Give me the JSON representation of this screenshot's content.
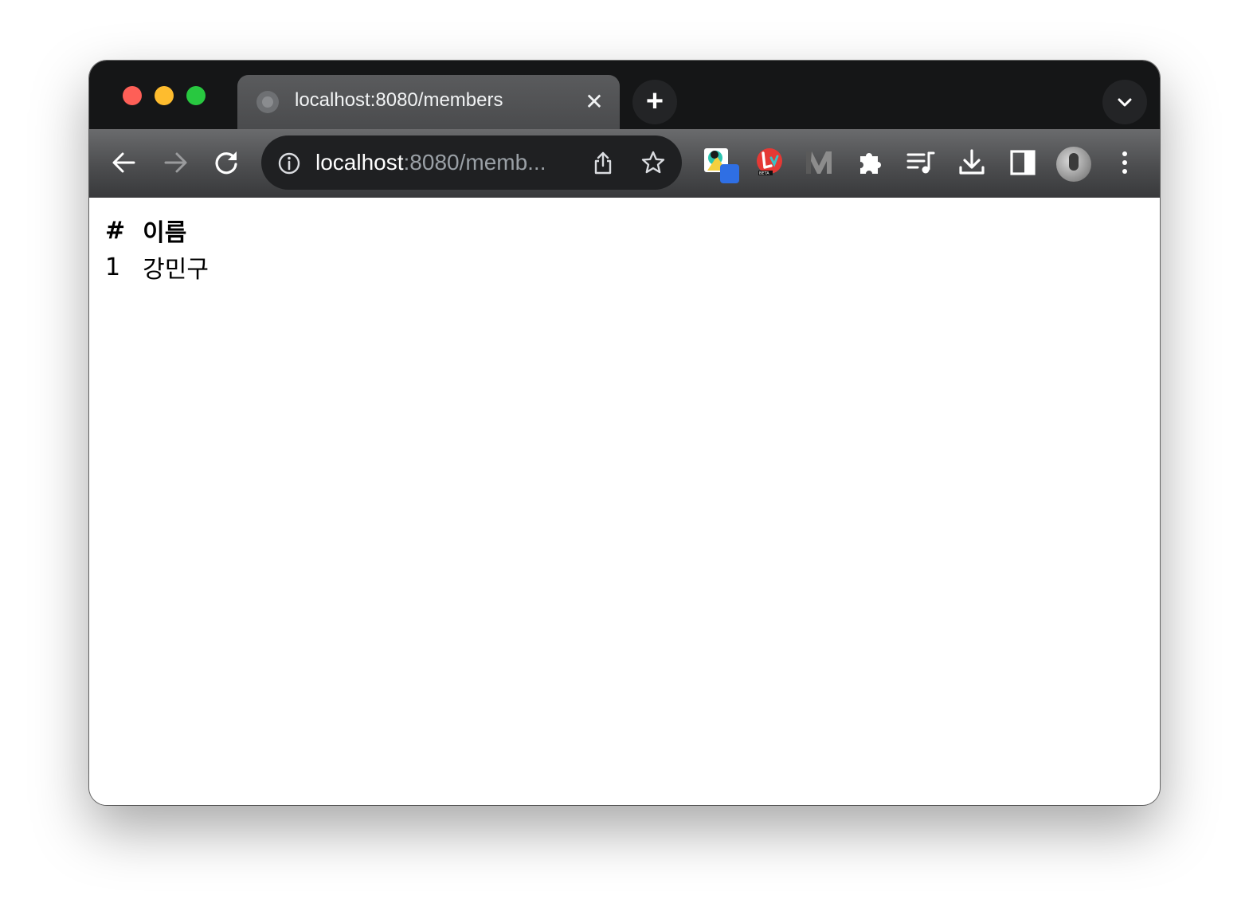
{
  "browser": {
    "tab": {
      "title": "localhost:8080/members",
      "close_glyph": "✕",
      "favicon": "globe-icon"
    },
    "new_tab_glyph": "+",
    "omnibox": {
      "url_host": "localhost",
      "url_rest": ":8080/memb..."
    },
    "extensions": [
      "extension-1",
      "extension-beta",
      "extension-m",
      "puzzle-icon",
      "media-icon",
      "download-icon",
      "sidepanel-icon",
      "profile-avatar",
      "menu-icon"
    ]
  },
  "page": {
    "table": {
      "headers": [
        "#",
        "이름"
      ],
      "rows": [
        [
          "1",
          "강민구"
        ]
      ]
    }
  },
  "colors": {
    "close": "#fe5f57",
    "minimize": "#febc2e",
    "maximize": "#28c840"
  }
}
